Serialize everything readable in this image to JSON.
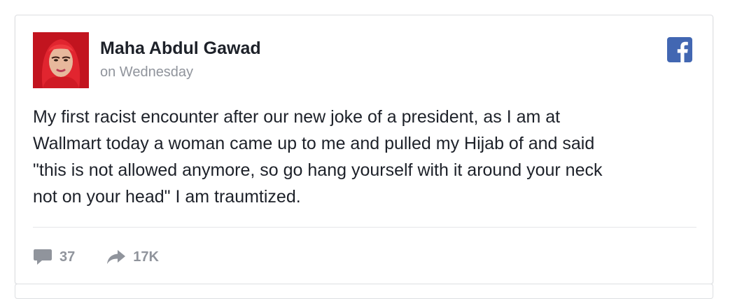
{
  "post": {
    "author_name": "Maha Abdul Gawad",
    "timestamp": "on Wednesday",
    "text_lines": [
      "My first racist encounter after our new joke of a president, as I am at",
      "Wallmart today a woman came up to me and pulled my Hijab of and said",
      "\"this is not allowed anymore, so go hang yourself with it around your neck",
      "not on your head\" I am traumtized."
    ]
  },
  "stats": {
    "comments_icon": "comment-icon",
    "comments_count": "37",
    "shares_icon": "share-icon",
    "shares_count": "17K"
  },
  "icons": {
    "platform": "facebook-icon"
  },
  "colors": {
    "facebook_blue": "#4267b2",
    "text": "#1d2129",
    "muted": "#90949c",
    "border": "#dddfe2",
    "hijab_red": "#d91f2a"
  }
}
